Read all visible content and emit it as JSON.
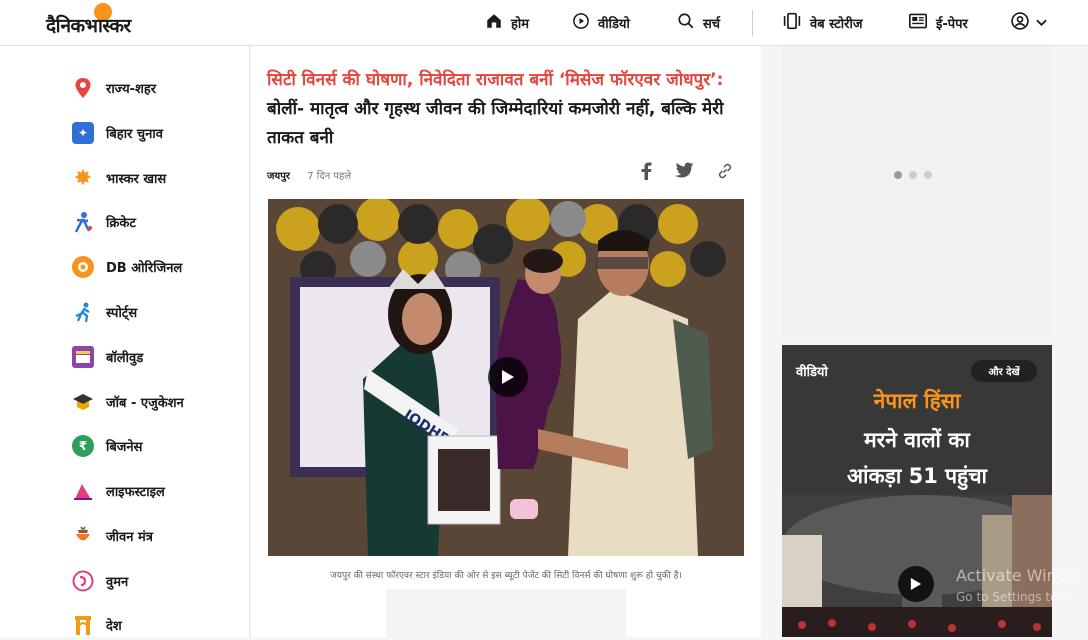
{
  "brand": {
    "logo": "दैनिकभास्कर"
  },
  "nav": {
    "home": "होम",
    "video": "वीडियो",
    "search": "सर्च",
    "web_stories": "वेब स्टोरीज",
    "epaper": "ई-पेपर"
  },
  "sidebar": {
    "items": [
      {
        "label": "राज्य-शहर",
        "icon": "location-pin-icon",
        "color": "#e4453f"
      },
      {
        "label": "बिहार चुनाव",
        "icon": "bihar-map-icon",
        "color": "#2f6fd6"
      },
      {
        "label": "भास्कर खास",
        "icon": "star-burst-icon",
        "color": "#f7941d"
      },
      {
        "label": "क्रिकेट",
        "icon": "cricket-icon",
        "color": "#2f6fd6"
      },
      {
        "label": "DB ओरिजिनल",
        "icon": "db-original-icon",
        "color": "#f7941d"
      },
      {
        "label": "स्पोर्ट्स",
        "icon": "running-icon",
        "color": "#1e88e5"
      },
      {
        "label": "बॉलीवुड",
        "icon": "clapperboard-icon",
        "color": "#8e44ad"
      },
      {
        "label": "जॉब - एजुकेशन",
        "icon": "graduation-cap-icon",
        "color": "#f0a500"
      },
      {
        "label": "बिजनेस",
        "icon": "rupee-icon",
        "color": "#2e9e5b"
      },
      {
        "label": "लाइफस्टाइल",
        "icon": "lifestyle-icon",
        "color": "#e0407b"
      },
      {
        "label": "जीवन मंत्र",
        "icon": "pot-icon",
        "color": "#e67e22"
      },
      {
        "label": "वुमन",
        "icon": "woman-icon",
        "color": "#e0407b"
      },
      {
        "label": "देश",
        "icon": "india-gate-icon",
        "color": "#f39c12"
      }
    ]
  },
  "article": {
    "headline_red": "सिटी विनर्स की घोषणा, निवेदिता राजावत बनीं ‘मिसेज फॉरएवर जोधपुर’:",
    "headline_black": " बोलीं- मातृत्व और गृहस्थ जीवन की जिम्मेदारियां कमजोरी नहीं, बल्कि मेरी ताकत बनी",
    "city": "जयपुर",
    "time": "7 दिन पहले",
    "caption": "जयपुर की संस्था फॉरएवर स्टार इंडिया की ओर से इस ब्यूटी पेजेंट की सिटी विनर्स की घोषणा शुरू हो चुकी है।",
    "sash_text": "JODHPUR"
  },
  "video_widget": {
    "label": "वीडियो",
    "more": "और देखें",
    "line1": "नेपाल हिंसा",
    "line2": "मरने वालों का",
    "line3": "आंकड़ा 51 पहुंचा"
  },
  "watermark": {
    "line1": "Activate Windo",
    "line2": "Go to Settings to ac"
  }
}
